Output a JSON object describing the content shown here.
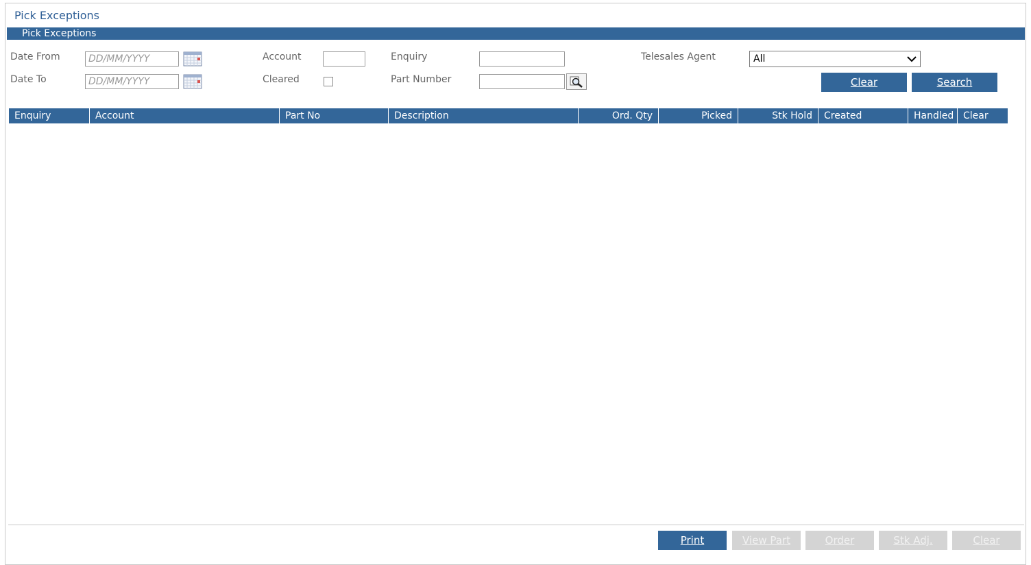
{
  "page": {
    "title": "Pick Exceptions",
    "section_title": "Pick Exceptions"
  },
  "filters": {
    "date_from_label": "Date From",
    "date_from_placeholder": "DD/MM/YYYY",
    "date_to_label": "Date To",
    "date_to_placeholder": "DD/MM/YYYY",
    "account_label": "Account",
    "account_value": "",
    "cleared_label": "Cleared",
    "enquiry_label": "Enquiry",
    "enquiry_value": "",
    "part_number_label": "Part Number",
    "part_number_value": "",
    "telesales_agent_label": "Telesales Agent",
    "telesales_agent_value": "All",
    "clear_button": "Clear",
    "search_button": "Search"
  },
  "grid": {
    "columns": [
      "Enquiry",
      "Account",
      "Part No",
      "Description",
      "Ord. Qty",
      "Picked",
      "Stk Hold",
      "Created",
      "Handled",
      "Clear"
    ],
    "rows": []
  },
  "footer": {
    "print_button": "Print",
    "view_part_button": "View Part",
    "order_button": "Order",
    "stk_adj_button": "Stk Adj.",
    "clear_button": "Clear"
  },
  "icons": {
    "calendar": "calendar-icon",
    "lookup": "magnifier-icon",
    "dropdown": "chevron-down-icon"
  },
  "colors": {
    "accent": "#336699",
    "disabled": "#d4d4d4"
  }
}
